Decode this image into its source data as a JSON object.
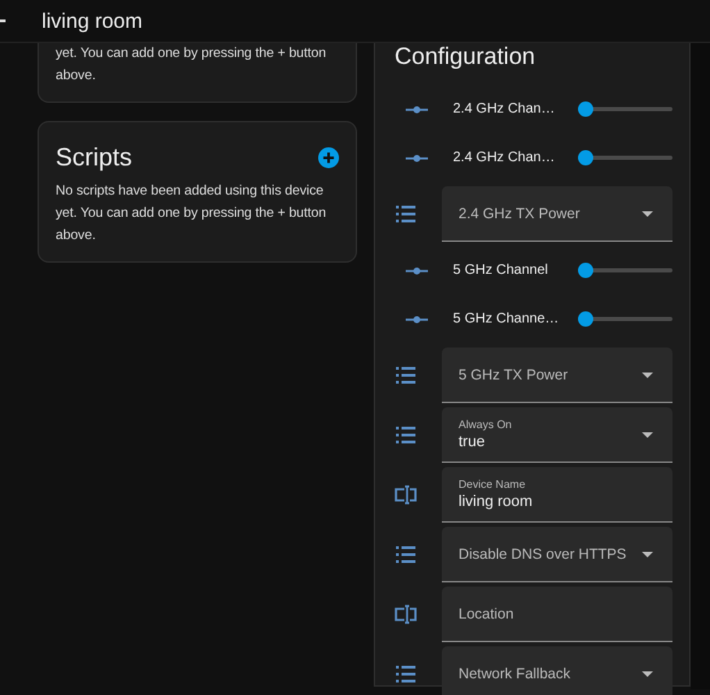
{
  "header": {
    "title": "living room"
  },
  "cards": [
    {
      "text": "yet. You can add one by pressing the + button above."
    },
    {
      "title": "Scripts",
      "has_add_button": true,
      "text": "No scripts have been added using this device yet. You can add one by pressing the + button above."
    }
  ],
  "configuration": {
    "title": "Configuration",
    "entities": [
      {
        "kind": "slider",
        "label": "2.4 GHz Chan…",
        "level": 0
      },
      {
        "kind": "slider",
        "label": "2.4 GHz Chan…",
        "level": 0
      },
      {
        "kind": "select",
        "label": "2.4 GHz TX Power"
      },
      {
        "kind": "slider",
        "label": "5 GHz Channel",
        "level": 0
      },
      {
        "kind": "slider",
        "label": "5 GHz Channe…",
        "level": 0
      },
      {
        "kind": "select",
        "label": "5 GHz TX Power"
      },
      {
        "kind": "select",
        "label": "Always On",
        "value": "true"
      },
      {
        "kind": "text",
        "label": "Device Name",
        "value": "living room"
      },
      {
        "kind": "select",
        "label": "Disable DNS over HTTPS"
      },
      {
        "kind": "text",
        "label": "Location"
      },
      {
        "kind": "select",
        "label": "Network Fallback"
      }
    ]
  }
}
